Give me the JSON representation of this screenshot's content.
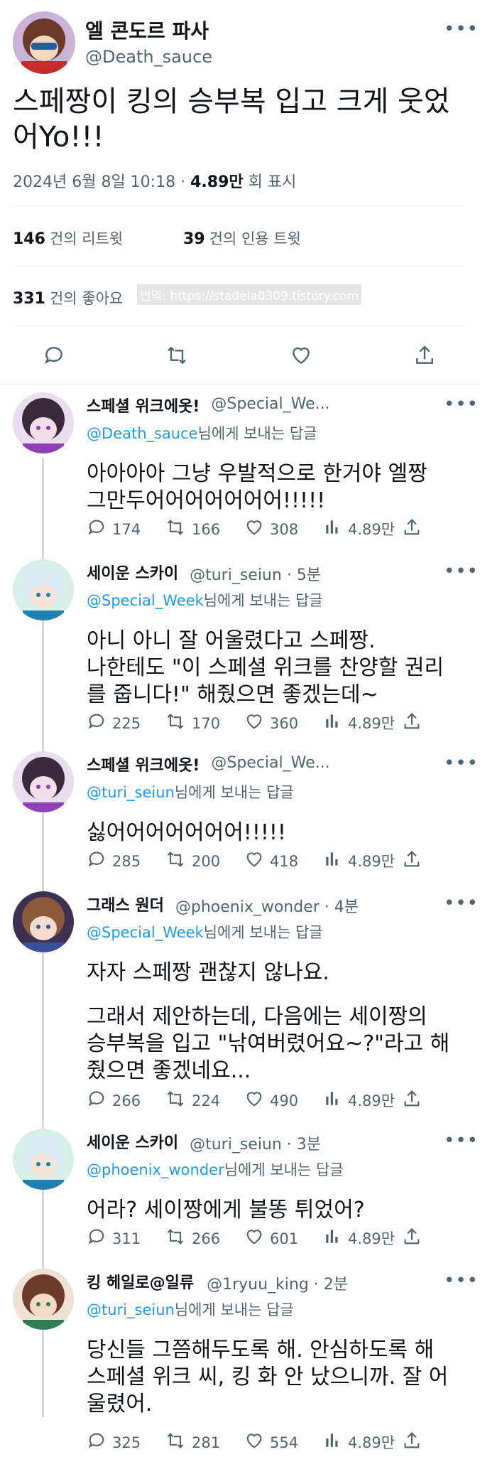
{
  "main_tweet": {
    "display_name": "엘 콘도르 파사",
    "handle": "@Death_sauce",
    "text_line1": "스페짱이 킹의 승부복 입고 크게 웃었",
    "text_line2": "어Yo!!!",
    "date": "2024년 6월 8일  10:18",
    "views_count": "4.89만",
    "views_label": "회 표시",
    "retweets_count": "146",
    "retweets_label": "건의 리트윗",
    "quotes_count": "39",
    "quotes_label": "건의 인용 트윗",
    "likes_count": "331",
    "likes_label": "건의 좋아요",
    "watermark": "번역: https://stadela0309.tistory.com"
  },
  "icons": {
    "reply": "reply-icon",
    "retweet": "retweet-icon",
    "like": "heart-icon",
    "share": "share-icon",
    "views": "views-icon",
    "more": "more-icon"
  },
  "colors": {
    "link": "#1d9bf0",
    "secondary": "#536471",
    "text": "#0f1419"
  },
  "replies": [
    {
      "display_name": "스페셜 위크에옷!",
      "handle": "@Special_We...",
      "reply_to": "@Death_sauce",
      "reply_suffix": "님에게 보내는 답글",
      "paragraphs": [
        "아아아아 그냥 우발적으로 한거야 엘짱",
        "그만두어어어어어어어!!!!!"
      ],
      "replies": "174",
      "retweets": "166",
      "likes": "308",
      "views": "4.89만"
    },
    {
      "display_name": "세이운 스카이",
      "handle": "@turi_seiun · 5분",
      "reply_to": "@Special_Week",
      "reply_suffix": "님에게 보내는 답글",
      "paragraphs": [
        "아니 아니 잘 어울렸다고 스페짱.",
        "나한테도 \"이 스페셜 위크를 찬양할 권리",
        "를 줍니다!\" 해줬으면 좋겠는데~"
      ],
      "replies": "225",
      "retweets": "170",
      "likes": "360",
      "views": "4.89만"
    },
    {
      "display_name": "스페셜 위크에옷!",
      "handle": "@Special_We...",
      "reply_to": "@turi_seiun",
      "reply_suffix": "님에게 보내는 답글",
      "paragraphs": [
        "싫어어어어어어어!!!!!"
      ],
      "replies": "285",
      "retweets": "200",
      "likes": "418",
      "views": "4.89만"
    },
    {
      "display_name": "그래스 원더",
      "handle": "@phoenix_wonder · 4분",
      "reply_to": "@Special_Week",
      "reply_suffix": "님에게 보내는 답글",
      "paragraphs": [
        "자자 스페짱 괜찮지 않나요.",
        "그래서 제안하는데, 다음에는 세이짱의",
        "승부복을 입고 \"낚여버렸어요~?\"라고 해",
        "줬으면 좋겠네요..."
      ],
      "replies": "266",
      "retweets": "224",
      "likes": "490",
      "views": "4.89만"
    },
    {
      "display_name": "세이운 스카이",
      "handle": "@turi_seiun · 3분",
      "reply_to": "@phoenix_wonder",
      "reply_suffix": "님에게 보내는 답글",
      "paragraphs": [
        "어라? 세이짱에게 불똥 튀었어?"
      ],
      "replies": "311",
      "retweets": "266",
      "likes": "601",
      "views": "4.89만"
    },
    {
      "display_name": "킹 헤일로@일류",
      "handle": "@1ryuu_king · 2분",
      "reply_to": "@turi_seiun",
      "reply_suffix": "님에게 보내는 답글",
      "paragraphs": [
        "당신들 그쯤해두도록 해. 안심하도록 해",
        "스페셜 위크 씨, 킹 화 안 났으니까. 잘 어",
        "울렸어."
      ],
      "replies": "325",
      "retweets": "281",
      "likes": "554",
      "views": "4.89만"
    }
  ]
}
